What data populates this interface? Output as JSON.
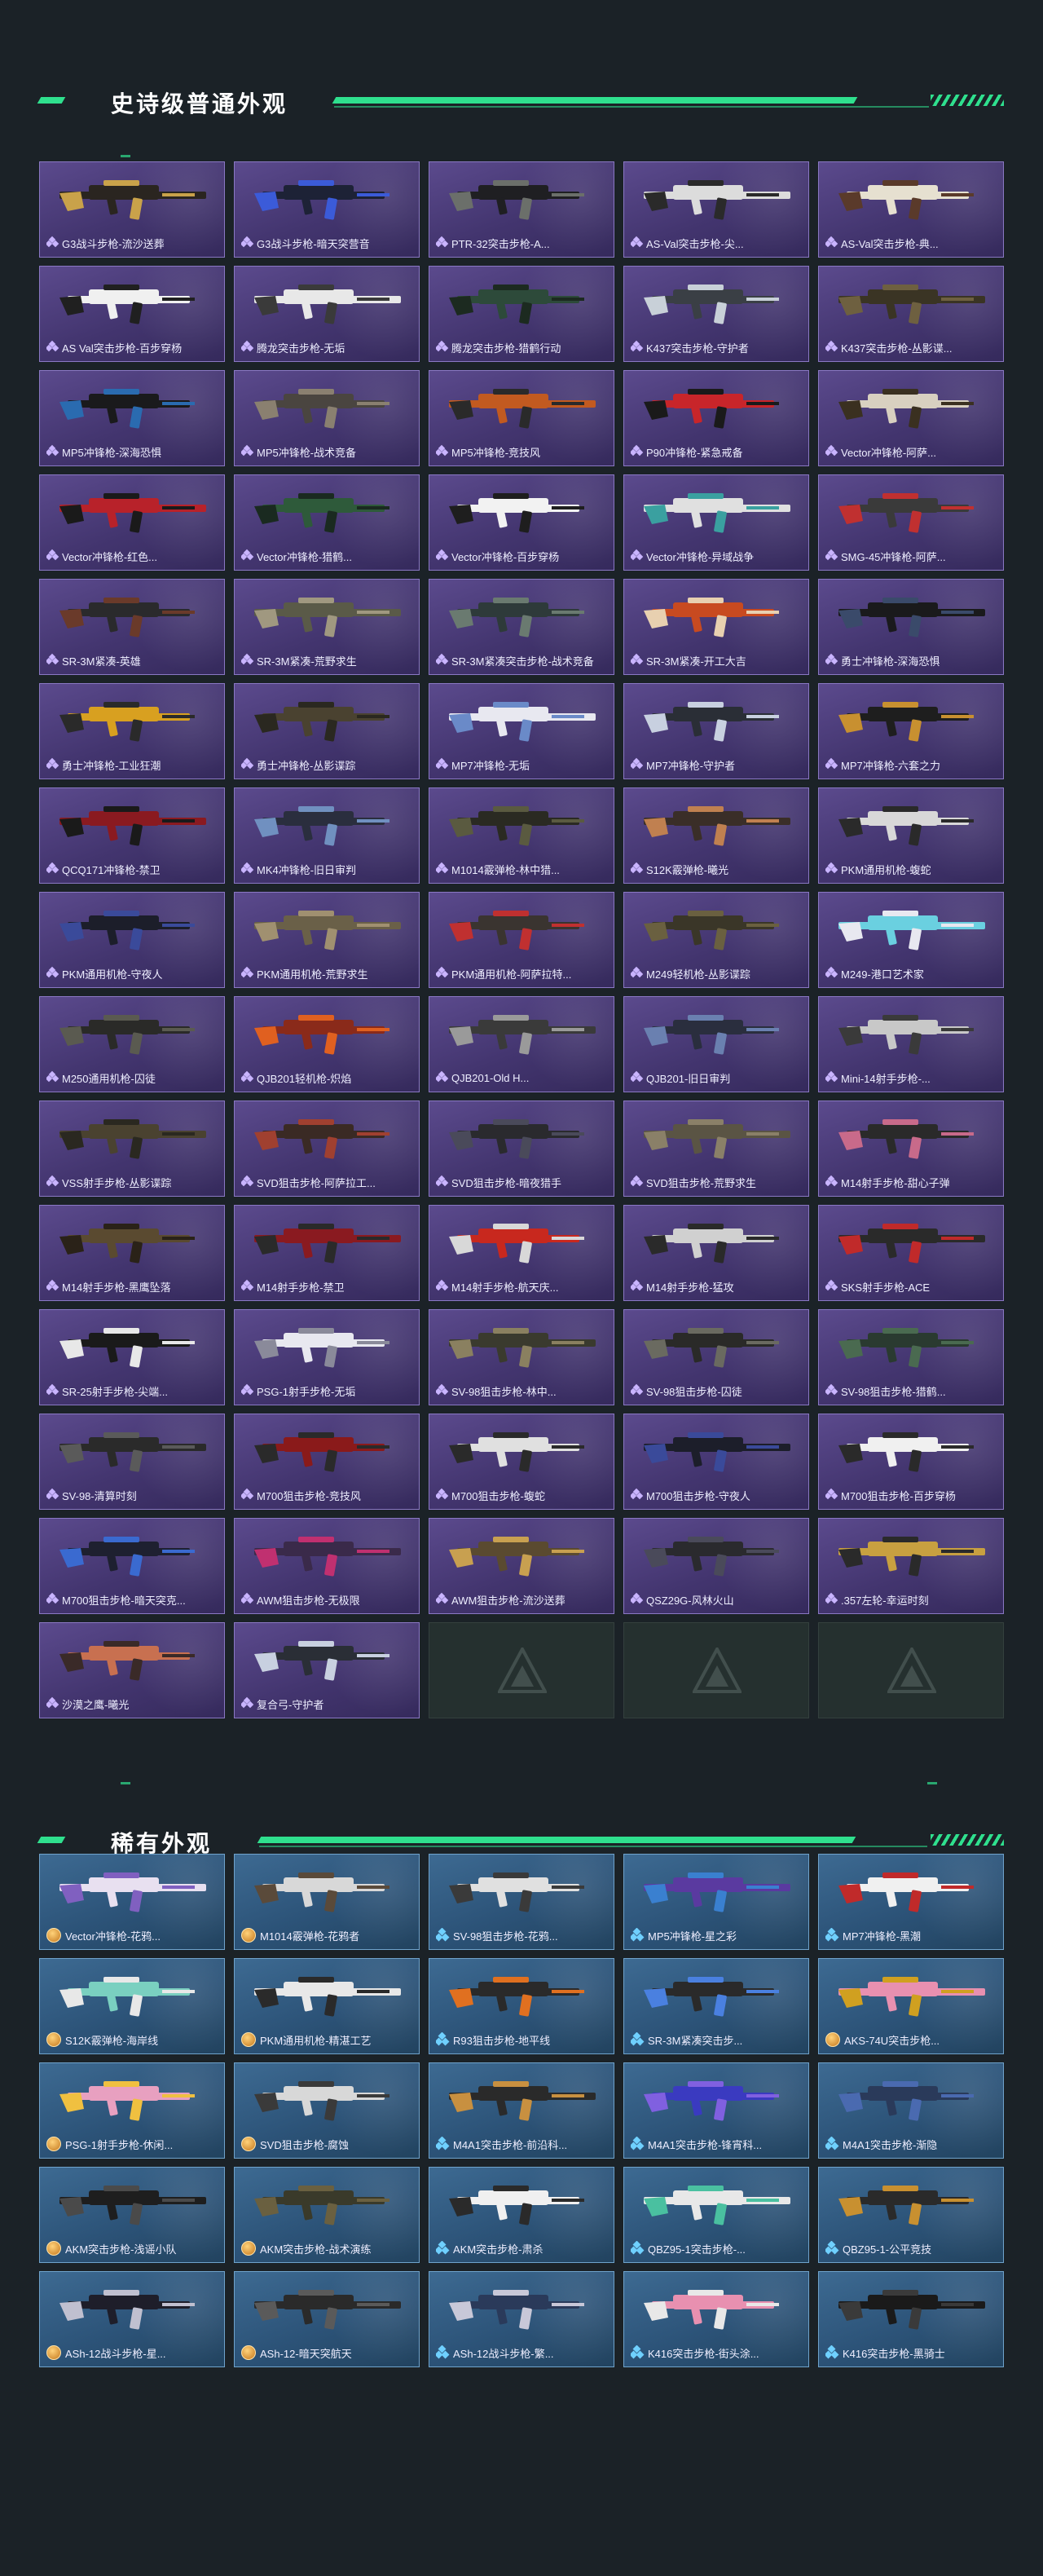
{
  "colors": {
    "accent": "#2fe08e",
    "epic_card": "#4a3b7c",
    "rare_card": "#2f587c",
    "background": "#1b2227"
  },
  "epic_section": {
    "title": "史诗级普通外观",
    "items": [
      {
        "name": "G3战斗步枪-流沙送葬",
        "palette": [
          "#2a2520",
          "#c9a24a"
        ]
      },
      {
        "name": "G3战斗步枪-暗天突营音",
        "palette": [
          "#1d2236",
          "#3b5bd9"
        ]
      },
      {
        "name": "PTR-32突击步枪-A...",
        "palette": [
          "#1f1f22",
          "#6b6f6a"
        ]
      },
      {
        "name": "AS-Val突击步枪-尖...",
        "palette": [
          "#dcdcdc",
          "#2a2a2a"
        ]
      },
      {
        "name": "AS-Val突击步枪-典...",
        "palette": [
          "#e6e0d0",
          "#5a3a2a"
        ]
      },
      {
        "name": "AS Val突击步枪-百步穿杨",
        "palette": [
          "#f0f0f0",
          "#202020"
        ]
      },
      {
        "name": "腾龙突击步枪-无垢",
        "palette": [
          "#e8e8e8",
          "#3a3a3a"
        ]
      },
      {
        "name": "腾龙突击步枪-猎鹤行动",
        "palette": [
          "#2d4a3a",
          "#1c2a20"
        ]
      },
      {
        "name": "K437突击步枪-守护者",
        "palette": [
          "#3a3f45",
          "#c8d0d8"
        ]
      },
      {
        "name": "K437突击步枪-丛影谍...",
        "palette": [
          "#3a3424",
          "#6e6040"
        ]
      },
      {
        "name": "MP5冲锋枪-深海恐惧",
        "palette": [
          "#1a1a1c",
          "#2a6bb0"
        ]
      },
      {
        "name": "MP5冲锋枪-战术竞备",
        "palette": [
          "#4a4540",
          "#8a8070"
        ]
      },
      {
        "name": "MP5冲锋枪-竞技风",
        "palette": [
          "#c25a20",
          "#2a2a2a"
        ]
      },
      {
        "name": "P90冲锋枪-紧急戒备",
        "palette": [
          "#c8252a",
          "#1a1a1a"
        ]
      },
      {
        "name": "Vector冲锋枪-阿萨...",
        "palette": [
          "#d8d0c0",
          "#3a3020"
        ]
      },
      {
        "name": "Vector冲锋枪-红色...",
        "palette": [
          "#b8222a",
          "#1a1a1a"
        ]
      },
      {
        "name": "Vector冲锋枪-猎鹤...",
        "palette": [
          "#2e5a3a",
          "#1a2a20"
        ]
      },
      {
        "name": "Vector冲锋枪-百步穿杨",
        "palette": [
          "#f2f2f2",
          "#1e1e1e"
        ]
      },
      {
        "name": "Vector冲锋枪-异域战争",
        "palette": [
          "#e0e0e0",
          "#3aa0a0"
        ]
      },
      {
        "name": "SMG-45冲锋枪-阿萨...",
        "palette": [
          "#3a3a3a",
          "#c03030"
        ]
      },
      {
        "name": "SR-3M紧凑-英雄",
        "palette": [
          "#2a2a2c",
          "#6a3a2a"
        ]
      },
      {
        "name": "SR-3M紧凑-荒野求生",
        "palette": [
          "#5a5a48",
          "#a09880"
        ]
      },
      {
        "name": "SR-3M紧凑突击步枪-战术竞备",
        "palette": [
          "#2e3a3a",
          "#6a7a70"
        ]
      },
      {
        "name": "SR-3M紧凑-开工大吉",
        "palette": [
          "#c84a20",
          "#e8d0b0"
        ]
      },
      {
        "name": "勇士冲锋枪-深海恐惧",
        "palette": [
          "#1a1a1c",
          "#3a4a6a"
        ]
      },
      {
        "name": "勇士冲锋枪-工业狂潮",
        "palette": [
          "#d8a020",
          "#2a2a2a"
        ]
      },
      {
        "name": "勇士冲锋枪-丛影谍踪",
        "palette": [
          "#4a4230",
          "#2a2820"
        ]
      },
      {
        "name": "MP7冲锋枪-无垢",
        "palette": [
          "#e8e8f0",
          "#6a8ac8"
        ]
      },
      {
        "name": "MP7冲锋枪-守护者",
        "palette": [
          "#2a2e36",
          "#c8d0e0"
        ]
      },
      {
        "name": "MP7冲锋枪-六套之力",
        "palette": [
          "#1e1e1e",
          "#c89030"
        ]
      },
      {
        "name": "QCQ171冲锋枪-禁卫",
        "palette": [
          "#8a1a20",
          "#1a1a1a"
        ]
      },
      {
        "name": "MK4冲锋枪-旧日审判",
        "palette": [
          "#2a2e3e",
          "#7090c0"
        ]
      },
      {
        "name": "M1014霰弹枪-林中猎...",
        "palette": [
          "#2a2a22",
          "#5a5a40"
        ]
      },
      {
        "name": "S12K霰弹枪-曦光",
        "palette": [
          "#3a2e28",
          "#c08050"
        ]
      },
      {
        "name": "PKM通用机枪-蝮蛇",
        "palette": [
          "#d8d8d8",
          "#2a2a2a"
        ]
      },
      {
        "name": "PKM通用机枪-守夜人",
        "palette": [
          "#1c1e2a",
          "#3a4a9a"
        ]
      },
      {
        "name": "PKM通用机枪-荒野求生",
        "palette": [
          "#6a6048",
          "#a09070"
        ]
      },
      {
        "name": "PKM通用机枪-阿萨拉特...",
        "palette": [
          "#3a3430",
          "#c03030"
        ]
      },
      {
        "name": "M249轻机枪-丛影谍踪",
        "palette": [
          "#3a3628",
          "#6a6040"
        ]
      },
      {
        "name": "M249-港口艺术家",
        "palette": [
          "#6ad0e0",
          "#e8e8f0"
        ]
      },
      {
        "name": "M250通用机枪-囚徒",
        "palette": [
          "#2a2a28",
          "#5a5a50"
        ]
      },
      {
        "name": "QJB201轻机枪-炽焰",
        "palette": [
          "#8a2a1a",
          "#e06020"
        ]
      },
      {
        "name": "QJB201-Old H...",
        "palette": [
          "#3a3a3a",
          "#9a9a9a"
        ]
      },
      {
        "name": "QJB201-旧日审判",
        "palette": [
          "#2a2e3e",
          "#6a80b0"
        ]
      },
      {
        "name": "Mini-14射手步枪-...",
        "palette": [
          "#c8c8c8",
          "#3a3a3a"
        ]
      },
      {
        "name": "VSS射手步枪-丛影谍踪",
        "palette": [
          "#4a4230",
          "#2a2820"
        ]
      },
      {
        "name": "SVD狙击步枪-阿萨拉工...",
        "palette": [
          "#3a2a24",
          "#a04030"
        ]
      },
      {
        "name": "SVD狙击步枪-暗夜猎手",
        "palette": [
          "#2a2a2e",
          "#4a4a5a"
        ]
      },
      {
        "name": "SVD狙击步枪-荒野求生",
        "palette": [
          "#5a5444",
          "#8a8068"
        ]
      },
      {
        "name": "M14射手步枪-甜心子弹",
        "palette": [
          "#2a2a2a",
          "#c86a8a"
        ]
      },
      {
        "name": "M14射手步枪-黑鹰坠落",
        "palette": [
          "#5a4a30",
          "#2a2218"
        ]
      },
      {
        "name": "M14射手步枪-禁卫",
        "palette": [
          "#8a1a20",
          "#2a2a2a"
        ]
      },
      {
        "name": "M14射手步枪-航天庆...",
        "palette": [
          "#c8281e",
          "#d8d8d8"
        ]
      },
      {
        "name": "M14射手步枪-猛攻",
        "palette": [
          "#d0d0d0",
          "#2a2a2a"
        ]
      },
      {
        "name": "SKS射手步枪-ACE",
        "palette": [
          "#2a2a2a",
          "#c02a2a"
        ]
      },
      {
        "name": "SR-25射手步枪-尖端...",
        "palette": [
          "#1a1a1a",
          "#e8e8e8"
        ]
      },
      {
        "name": "PSG-1射手步枪-无垢",
        "palette": [
          "#e8e8f0",
          "#8a8a9a"
        ]
      },
      {
        "name": "SV-98狙击步枪-林中...",
        "palette": [
          "#3a3a2e",
          "#8a8060"
        ]
      },
      {
        "name": "SV-98狙击步枪-囚徒",
        "palette": [
          "#2a2a28",
          "#6a6a60"
        ]
      },
      {
        "name": "SV-98狙击步枪-猎鹤...",
        "palette": [
          "#2a3a30",
          "#4a6a50"
        ]
      },
      {
        "name": "SV-98-清算时刻",
        "palette": [
          "#2a2a2a",
          "#5a5a5a"
        ]
      },
      {
        "name": "M700狙击步枪-竞技风",
        "palette": [
          "#8a1a1a",
          "#2a2a2a"
        ]
      },
      {
        "name": "M700狙击步枪-蝮蛇",
        "palette": [
          "#e0e0e0",
          "#2a2a2a"
        ]
      },
      {
        "name": "M700狙击步枪-守夜人",
        "palette": [
          "#1c1e2a",
          "#3a4a9a"
        ]
      },
      {
        "name": "M700狙击步枪-百步穿杨",
        "palette": [
          "#f0f0f0",
          "#2a2a2a"
        ]
      },
      {
        "name": "M700狙击步枪-暗天突克...",
        "palette": [
          "#1e2030",
          "#3a6ad0"
        ]
      },
      {
        "name": "AWM狙击步枪-无极限",
        "palette": [
          "#3a2a4a",
          "#c03070"
        ]
      },
      {
        "name": "AWM狙击步枪-流沙送葬",
        "palette": [
          "#5a4a30",
          "#c8a050"
        ]
      },
      {
        "name": "QSZ29G-风林火山",
        "palette": [
          "#2a2a2e",
          "#4a4a5a"
        ]
      },
      {
        "name": ".357左轮-幸运时刻",
        "palette": [
          "#c8a040",
          "#2a2a2a"
        ]
      },
      {
        "name": "沙漠之鹰-曦光",
        "palette": [
          "#c87050",
          "#3a2a28"
        ]
      },
      {
        "name": "复合弓-守护者",
        "palette": [
          "#2a2e36",
          "#c8d0e0"
        ]
      }
    ]
  },
  "rare_section": {
    "title": "稀有外观",
    "items": [
      {
        "name": "Vector冲锋枪-花鸦...",
        "palette": [
          "#e8e0f0",
          "#8060c0"
        ]
      },
      {
        "name": "M1014霰弹枪-花鸦者",
        "palette": [
          "#d8d8d8",
          "#5a4a3a"
        ]
      },
      {
        "name": "SV-98狙击步枪-花鸦...",
        "palette": [
          "#e0e0e0",
          "#3a3a3a"
        ]
      },
      {
        "name": "MP5冲锋枪-星之彩",
        "palette": [
          "#5a3aa0",
          "#3a80d0"
        ]
      },
      {
        "name": "MP7冲锋枪-黑潮",
        "palette": [
          "#f0f0f0",
          "#c02a2a"
        ]
      },
      {
        "name": "S12K霰弹枪-海岸线",
        "palette": [
          "#7ad0c0",
          "#e8e8e8"
        ]
      },
      {
        "name": "PKM通用机枪-精湛工艺",
        "palette": [
          "#e8e8e8",
          "#2a2a2a"
        ]
      },
      {
        "name": "R93狙击步枪-地平线",
        "palette": [
          "#2a2a2a",
          "#e07020"
        ]
      },
      {
        "name": "SR-3M紧凑突击步...",
        "palette": [
          "#2a2a2a",
          "#4a80e0"
        ]
      },
      {
        "name": "AKS-74U突击步枪...",
        "palette": [
          "#e890b0",
          "#d0a020"
        ]
      },
      {
        "name": "PSG-1射手步枪-休闲...",
        "palette": [
          "#e8a0c0",
          "#f0c040"
        ]
      },
      {
        "name": "SVD狙击步枪-腐蚀",
        "palette": [
          "#d8d8d8",
          "#3a3a3a"
        ]
      },
      {
        "name": "M4A1突击步枪-前沿科...",
        "palette": [
          "#2a2a2a",
          "#c89040"
        ]
      },
      {
        "name": "M4A1突击步枪-锋宵科...",
        "palette": [
          "#3a3ac0",
          "#8060e0"
        ]
      },
      {
        "name": "M4A1突击步枪-渐隐",
        "palette": [
          "#2a3a5a",
          "#4a6ab0"
        ]
      },
      {
        "name": "AKM突击步枪-浅谣小队",
        "palette": [
          "#1e1e1e",
          "#4a4a4a"
        ]
      },
      {
        "name": "AKM突击步枪-战术演练",
        "palette": [
          "#3a3a2a",
          "#6a6040"
        ]
      },
      {
        "name": "AKM突击步枪-肃杀",
        "palette": [
          "#f0f0f0",
          "#2a2a2a"
        ]
      },
      {
        "name": "QBZ95-1突击步枪-...",
        "palette": [
          "#e8e8e8",
          "#4ac0a0"
        ]
      },
      {
        "name": "QBZ95-1-公平竞技",
        "palette": [
          "#2a2a2a",
          "#c89030"
        ]
      },
      {
        "name": "ASh-12战斗步枪-星...",
        "palette": [
          "#1e1e2a",
          "#c0c0d0"
        ]
      },
      {
        "name": "ASh-12-暗天突航天",
        "palette": [
          "#2a2a2a",
          "#5a5a5a"
        ]
      },
      {
        "name": "ASh-12战斗步枪-繁...",
        "palette": [
          "#2a3a5a",
          "#c8c8d8"
        ]
      },
      {
        "name": "K416突击步枪-街头涂...",
        "palette": [
          "#e890b0",
          "#e8e8e8"
        ]
      },
      {
        "name": "K416突击步枪-黑骑士",
        "palette": [
          "#1a1a1a",
          "#3a3a3a"
        ]
      }
    ]
  }
}
